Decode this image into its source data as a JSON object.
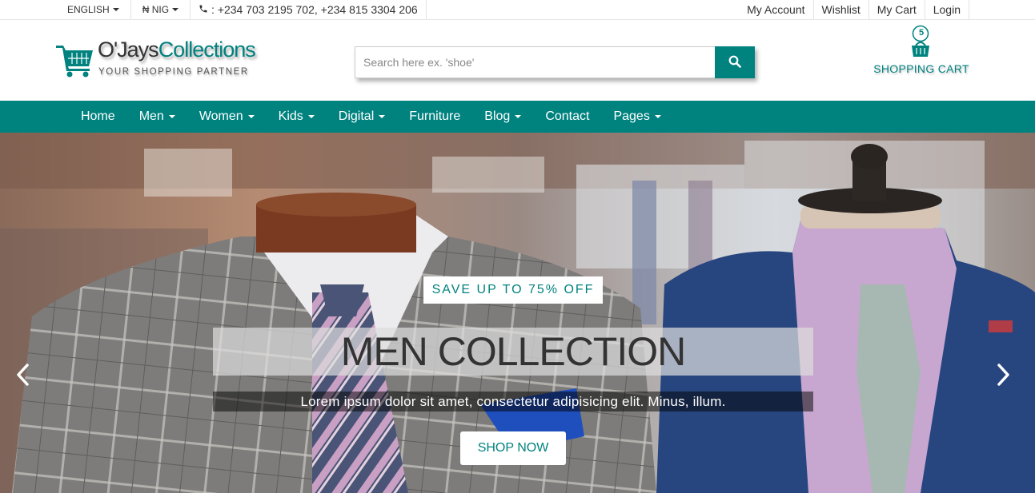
{
  "topbar": {
    "language": "ENGLISH",
    "currency": "₦ NIG",
    "phones": "+234 703 2195 702, +234 815 3304 206",
    "links": [
      "My Account",
      "Wishlist",
      "My Cart",
      "Login"
    ]
  },
  "header": {
    "logo_main": "O'Jays",
    "logo_accent": "Collections",
    "tagline": "YOUR SHOPPING PARTNER",
    "search_placeholder": "Search here ex. 'shoe'",
    "cart_count": "5",
    "cart_label": "SHOPPING CART"
  },
  "nav": {
    "items": [
      {
        "label": "Home",
        "dropdown": false
      },
      {
        "label": "Men",
        "dropdown": true
      },
      {
        "label": "Women",
        "dropdown": true
      },
      {
        "label": "Kids",
        "dropdown": true
      },
      {
        "label": "Digital",
        "dropdown": true
      },
      {
        "label": "Furniture",
        "dropdown": false
      },
      {
        "label": "Blog",
        "dropdown": true
      },
      {
        "label": "Contact",
        "dropdown": false
      },
      {
        "label": "Pages",
        "dropdown": true
      }
    ]
  },
  "hero": {
    "promo": "SAVE UP TO 75% OFF",
    "headline": "MEN COLLECTION",
    "subtext": "Lorem ipsum dolor sit amet, consectetur adipisicing elit. Minus, illum.",
    "button": "SHOP NOW"
  },
  "colors": {
    "brand": "#00827f",
    "text": "#333333"
  },
  "icons": {
    "logo": "shopping-cart-icon",
    "search": "search-icon",
    "cart": "basket-icon",
    "phone": "phone-icon",
    "prev": "chevron-left-icon",
    "next": "chevron-right-icon"
  }
}
